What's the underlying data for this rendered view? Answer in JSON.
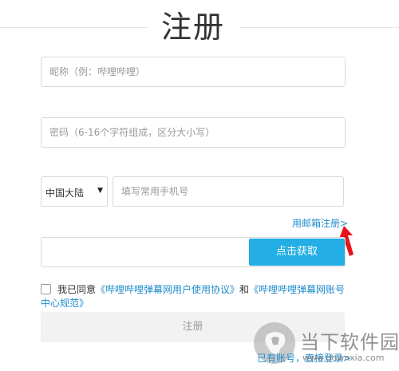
{
  "header": {
    "title": "注册"
  },
  "form": {
    "nickname_placeholder": "昵称（例：哔哩哔哩）",
    "password_placeholder": "密码（6-16个字符组成，区分大小写）",
    "country_value": "中国大陆",
    "phone_placeholder": "填写常用手机号",
    "email_register_link": "用邮箱注册>",
    "verification_code_value": "",
    "get_code_label": "点击获取",
    "agree_prefix": "我已同意",
    "agreement_user": "《哔哩哔哩弹幕网用户使用协议》",
    "agree_and": "和",
    "agreement_account": "《哔哩哔哩弹幕网账号中心规范》",
    "register_label": "注册"
  },
  "footer": {
    "has_account_text": "已有账号，",
    "login_link": "直接登录>"
  },
  "watermark": {
    "main": "当下软件园",
    "sub": "www.downxia.com"
  },
  "colors": {
    "link": "#1e8ccc",
    "primary_button": "#23aee5",
    "annotation_arrow": "#e8141b"
  }
}
